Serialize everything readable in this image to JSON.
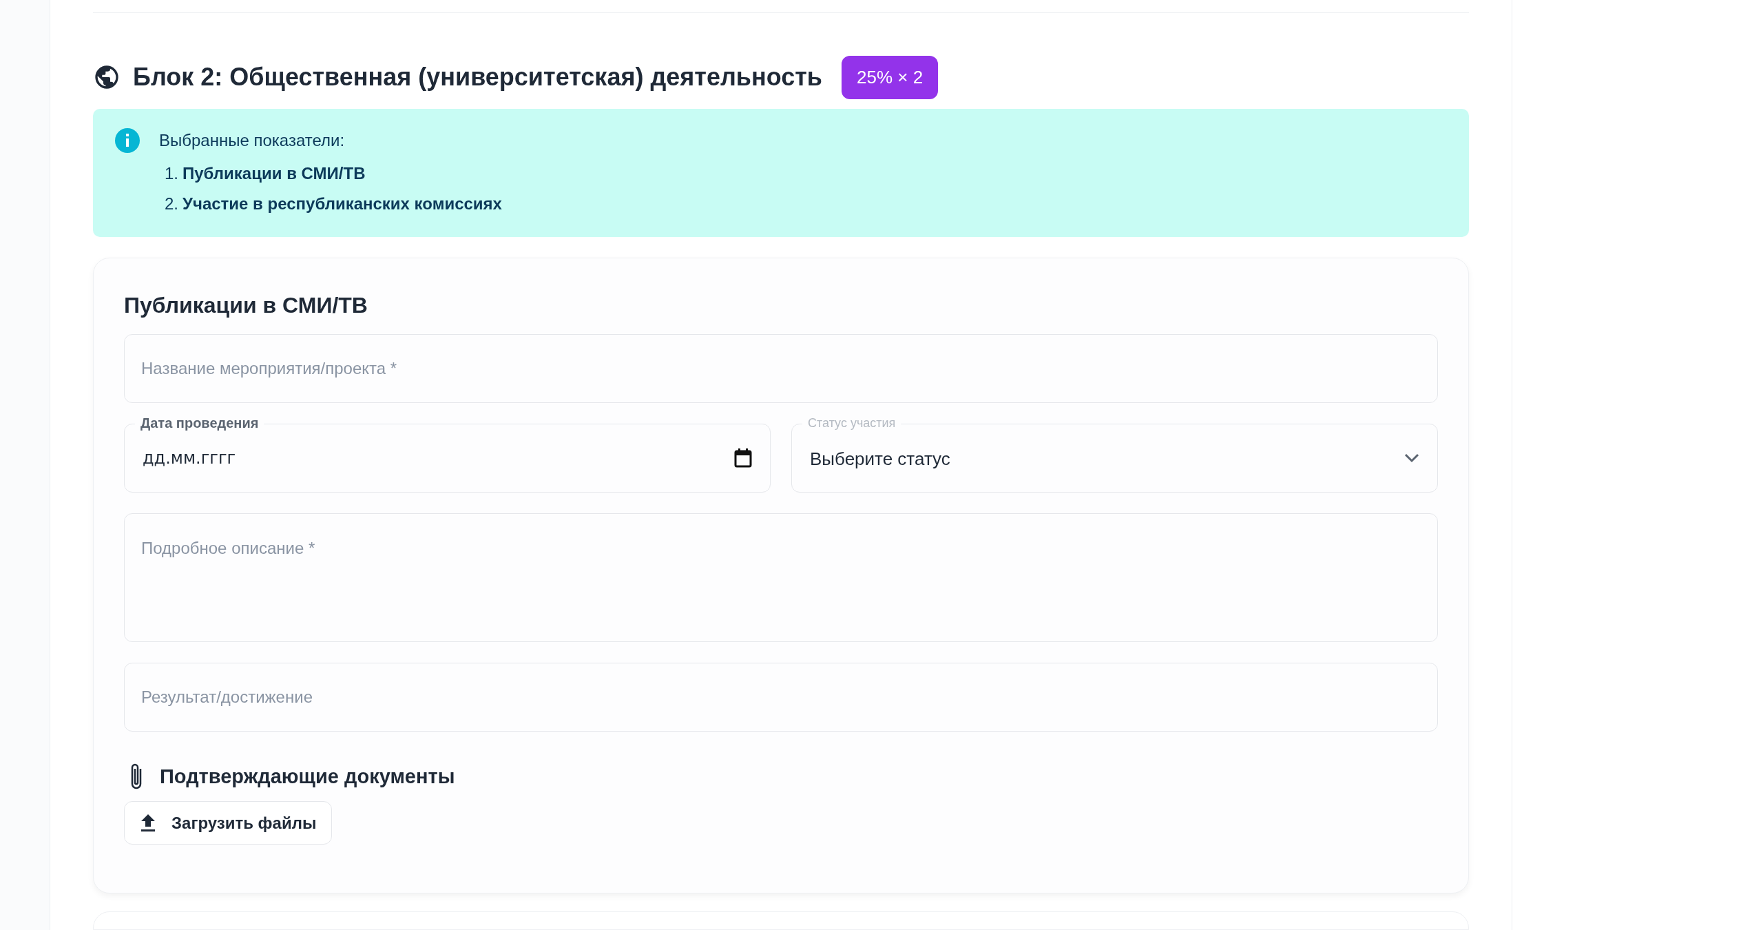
{
  "block": {
    "title": "Блок 2: Общественная (университетская) деятельность",
    "badge": "25% × 2"
  },
  "info": {
    "heading": "Выбранные показатели:",
    "items": [
      {
        "number": "1.",
        "text": "Публикации в СМИ/ТВ"
      },
      {
        "number": "2.",
        "text": "Участие в республиканских комиссиях"
      }
    ]
  },
  "form": {
    "title": "Публикации в СМИ/ТВ",
    "name_field": {
      "placeholder": "Название мероприятия/проекта *"
    },
    "date_field": {
      "label": "Дата проведения",
      "value": "дд.мм.гггг"
    },
    "status_select": {
      "label": "Статус участия",
      "value": "Выберите статус"
    },
    "description_field": {
      "placeholder": "Подробное описание *"
    },
    "result_field": {
      "placeholder": "Результат/достижение"
    },
    "documents": {
      "heading": "Подтверждающие документы",
      "upload_button": "Загрузить файлы"
    }
  }
}
